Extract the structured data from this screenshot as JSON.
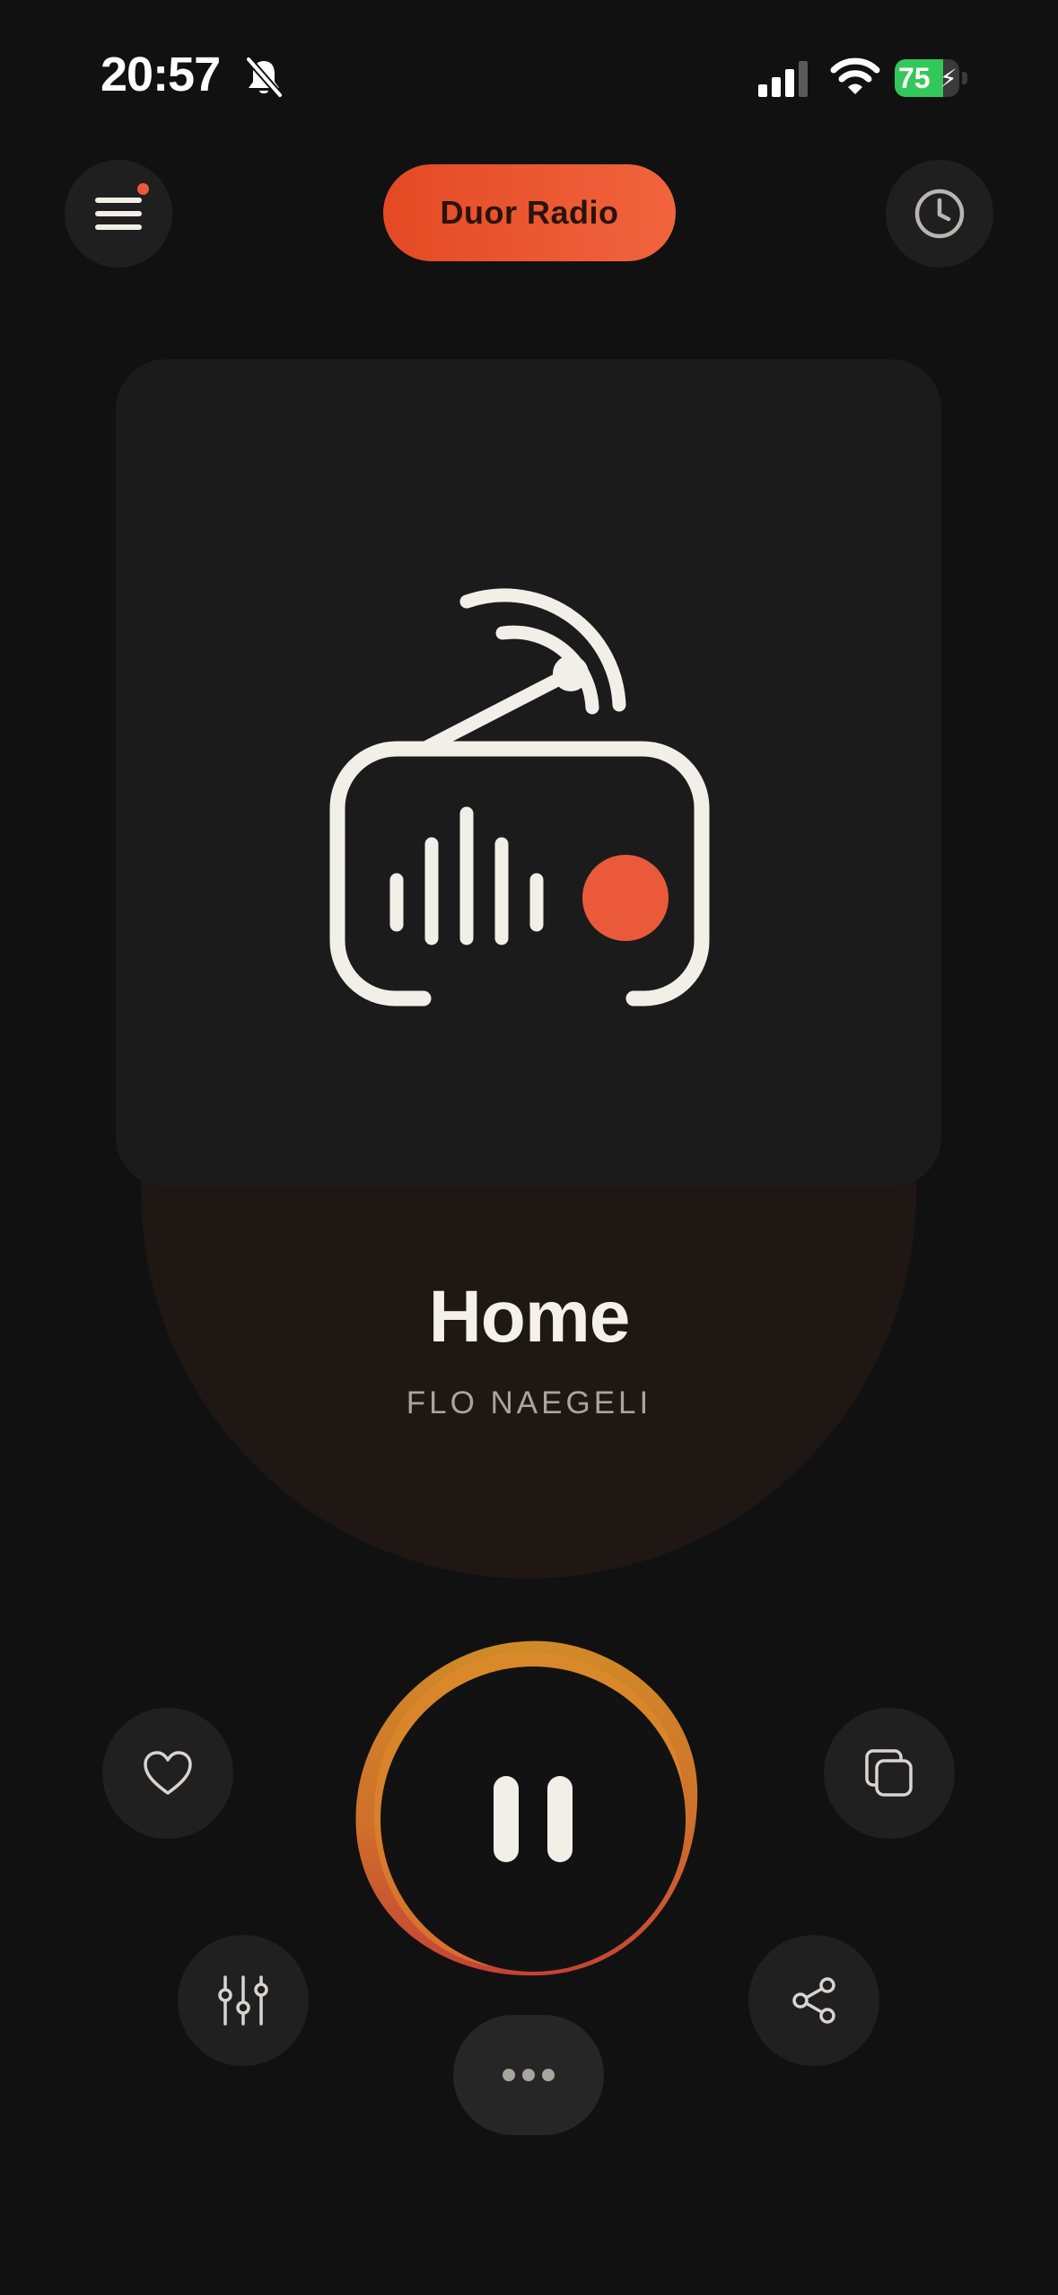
{
  "status_bar": {
    "time": "20:57",
    "battery": "75",
    "battery_level": 0.75,
    "icons": [
      "bell-slash-icon",
      "cellular-signal-icon",
      "wifi-icon",
      "battery-charging-icon"
    ]
  },
  "header": {
    "title": "Duor Radio",
    "menu_icon": "hamburger-menu-icon",
    "history_icon": "clock-icon",
    "notification_badge": true
  },
  "now_playing": {
    "artwork_icon": "radio-icon",
    "title": "Home",
    "artist": "FLO NAEGELI",
    "state": "playing"
  },
  "controls": {
    "favorite_icon": "heart-icon",
    "queue_icon": "copy-icon",
    "play_pause_icon": "pause-icon",
    "equalizer_icon": "sliders-icon",
    "share_icon": "share-icon",
    "more_icon": "ellipsis-icon"
  },
  "colors": {
    "background": "#111111",
    "accent": "#ea5a3a",
    "ring_start": "#e6982a",
    "ring_end": "#d9483a",
    "card": "#1b1b1b",
    "glow": "#1f1714"
  }
}
